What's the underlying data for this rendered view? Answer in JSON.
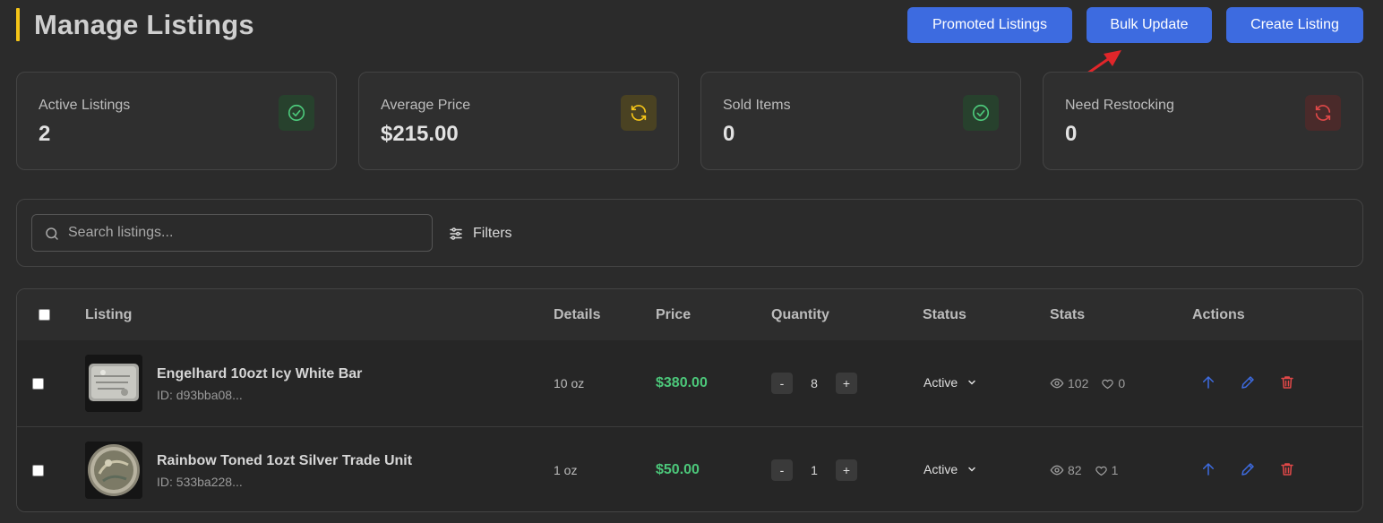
{
  "header": {
    "title": "Manage Listings",
    "buttons": {
      "promoted": "Promoted Listings",
      "bulk": "Bulk Update",
      "create": "Create Listing"
    },
    "accent_color": "#f5c518",
    "button_color": "#3d6be0"
  },
  "stats": [
    {
      "label": "Active Listings",
      "value": "2",
      "icon": "check-circle-icon",
      "color": "#4cc77a"
    },
    {
      "label": "Average Price",
      "value": "$215.00",
      "icon": "refresh-icon",
      "color": "#f5c518"
    },
    {
      "label": "Sold Items",
      "value": "0",
      "icon": "check-circle-icon",
      "color": "#4cc77a"
    },
    {
      "label": "Need Restocking",
      "value": "0",
      "icon": "refresh-icon",
      "color": "#e04848"
    }
  ],
  "search": {
    "placeholder": "Search listings...",
    "filters_label": "Filters"
  },
  "table": {
    "headers": {
      "listing": "Listing",
      "details": "Details",
      "price": "Price",
      "quantity": "Quantity",
      "status": "Status",
      "stats": "Stats",
      "actions": "Actions"
    },
    "rows": [
      {
        "title": "Engelhard 10ozt Icy White Bar",
        "id": "ID: d93bba08...",
        "details": "10 oz",
        "price": "$380.00",
        "quantity": "8",
        "status": "Active",
        "views": "102",
        "likes": "0"
      },
      {
        "title": "Rainbow Toned 1ozt Silver Trade Unit",
        "id": "ID: 533ba228...",
        "details": "1 oz",
        "price": "$50.00",
        "quantity": "1",
        "status": "Active",
        "views": "82",
        "likes": "1"
      }
    ],
    "qty_minus": "-",
    "qty_plus": "+"
  }
}
